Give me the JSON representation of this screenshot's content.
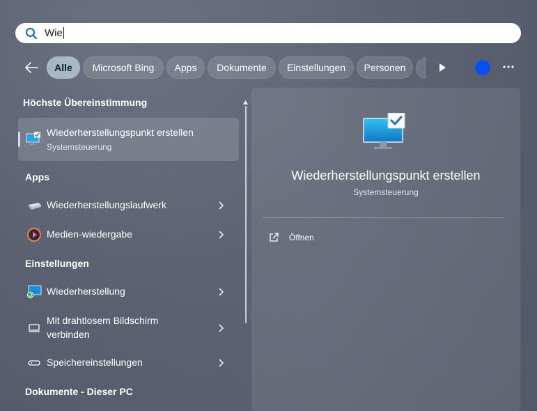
{
  "search": {
    "value": "Wie",
    "icon": "search-icon"
  },
  "filters": {
    "chips": [
      "Alle",
      "Microsoft Bing",
      "Apps",
      "Dokumente",
      "Einstellungen",
      "Personen"
    ],
    "active": "Alle",
    "colors": {
      "active_chip": "#a9b6c6",
      "profile_dot": "#0a4ff0"
    }
  },
  "results": {
    "best_match_heading": "Höchste Übereinstimmung",
    "best_match": {
      "title": "Wiederherstellungspunkt erstellen",
      "subtitle": "Systemsteuerung",
      "icon": "restore-point-monitor-icon"
    },
    "apps_heading": "Apps",
    "apps": [
      {
        "label": "Wiederherstellungslaufwerk",
        "icon": "recovery-drive-icon"
      },
      {
        "label": "Medien-wiedergabe",
        "icon": "media-player-icon"
      }
    ],
    "settings_heading": "Einstellungen",
    "settings": [
      {
        "label": "Wiederherstellung",
        "icon": "recovery-settings-icon"
      },
      {
        "label_line1": "Mit drahtlosem Bildschirm",
        "label_line2": "verbinden",
        "icon": "wireless-display-icon"
      },
      {
        "label": "Speichereinstellungen",
        "icon": "storage-icon"
      }
    ],
    "documents_heading": "Dokumente - Dieser PC"
  },
  "preview": {
    "title": "Wiederherstellungspunkt erstellen",
    "subtitle": "Systemsteuerung",
    "open_label": "Öffnen",
    "icon": "restore-point-monitor-icon"
  }
}
